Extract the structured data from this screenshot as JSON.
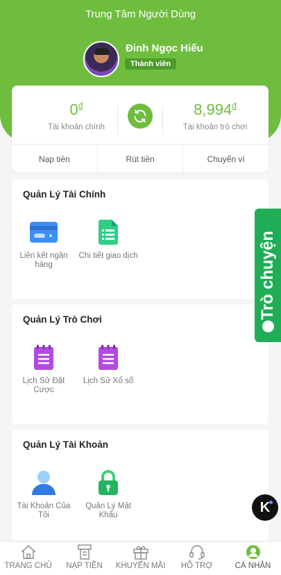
{
  "header": {
    "title": "Trung Tâm Người Dùng"
  },
  "user": {
    "name": "Đinh Ngọc Hiếu",
    "badge": "Thành viên"
  },
  "balances": {
    "main": {
      "amount": "0",
      "currency": "đ",
      "label": "Tài khoản chính"
    },
    "game": {
      "amount": "8,994",
      "currency": "đ",
      "label": "Tài khoản trò chơi"
    }
  },
  "actions": [
    "Nạp tiền",
    "Rút tiền",
    "Chuyển ví"
  ],
  "sections": {
    "finance": {
      "title": "Quản Lý Tài Chính",
      "items": [
        "Liên kết ngân hàng",
        "Chi tiết giao dịch"
      ]
    },
    "game": {
      "title": "Quản Lý Trò Chơi",
      "items": [
        "Lịch Sử Đặt Cược",
        "Lịch Sử Xổ số"
      ]
    },
    "account": {
      "title": "Quản Lý Tài Khoản",
      "items": [
        "Tài Khoản Của Tôi",
        "Quản Lý Mật Khẩu"
      ]
    }
  },
  "chat_tab": {
    "label": "Trò chuyện"
  },
  "floating_button": {
    "label": "K"
  },
  "bottom_nav": [
    "TRANG CHỦ",
    "NẠP TIỀN",
    "KHUYẾN MÃI",
    "HỖ TRỢ",
    "CÁ NHÂN"
  ],
  "colors": {
    "brand": "#6fbd3f",
    "chat": "#1fae55",
    "purple": "#b24be0"
  }
}
